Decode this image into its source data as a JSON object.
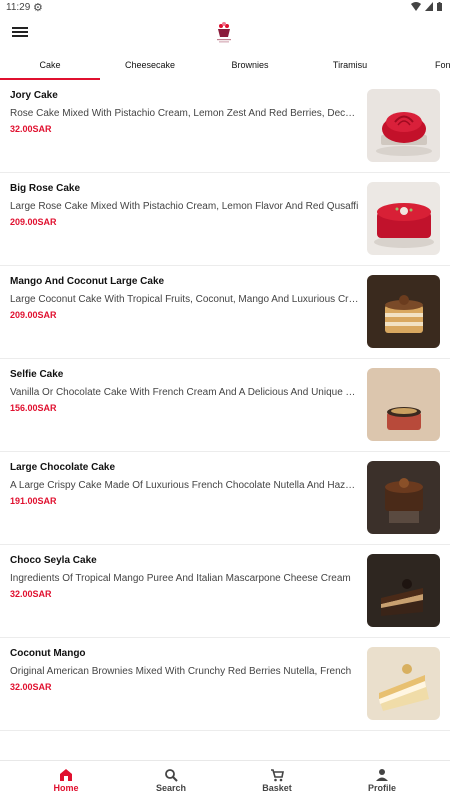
{
  "status_bar": {
    "time": "11:29"
  },
  "tabs": [
    {
      "label": "Cake"
    },
    {
      "label": "Cheesecake"
    },
    {
      "label": "Brownies"
    },
    {
      "label": "Tiramisu"
    },
    {
      "label": "Fon"
    }
  ],
  "products": [
    {
      "name": "Jory Cake",
      "description": "Rose Cake Mixed With Pistachio Cream, Lemon Zest And Red Berries, Decorated",
      "price": "32.00SAR",
      "image": "red-rose-cake"
    },
    {
      "name": "Big Rose Cake",
      "description": "Large Rose Cake Mixed With Pistachio Cream, Lemon Flavor And Red Qusaffi",
      "price": "209.00SAR",
      "image": "red-round-cake"
    },
    {
      "name": "Mango And Coconut Large Cake",
      "description": "Large Coconut Cake With Tropical Fruits, Coconut, Mango And Luxurious Cream",
      "price": "209.00SAR",
      "image": "layered-mango-cake"
    },
    {
      "name": "Selfie Cake",
      "description": "Vanilla Or Chocolate Cake With French Cream And A Delicious And Unique Taste",
      "price": "156.00SAR",
      "image": "selfie-cake"
    },
    {
      "name": "Large Chocolate Cake",
      "description": "A Large Crispy Cake Made Of Luxurious French Chocolate Nutella And Hazelnut",
      "price": "191.00SAR",
      "image": "chocolate-cake"
    },
    {
      "name": "Choco Seyla Cake",
      "description": "Ingredients Of Tropical Mango Puree And Italian Mascarpone Cheese Cream",
      "price": "32.00SAR",
      "image": "choco-slice"
    },
    {
      "name": "Coconut Mango",
      "description": "Original American Brownies Mixed With Crunchy Red Berries Nutella, French",
      "price": "32.00SAR",
      "image": "coconut-mango-slice"
    }
  ],
  "bottom_nav": [
    {
      "label": "Home",
      "icon": "home-icon"
    },
    {
      "label": "Search",
      "icon": "search-icon"
    },
    {
      "label": "Basket",
      "icon": "basket-icon"
    },
    {
      "label": "Profile",
      "icon": "profile-icon"
    }
  ],
  "colors": {
    "accent": "#e0102f"
  }
}
